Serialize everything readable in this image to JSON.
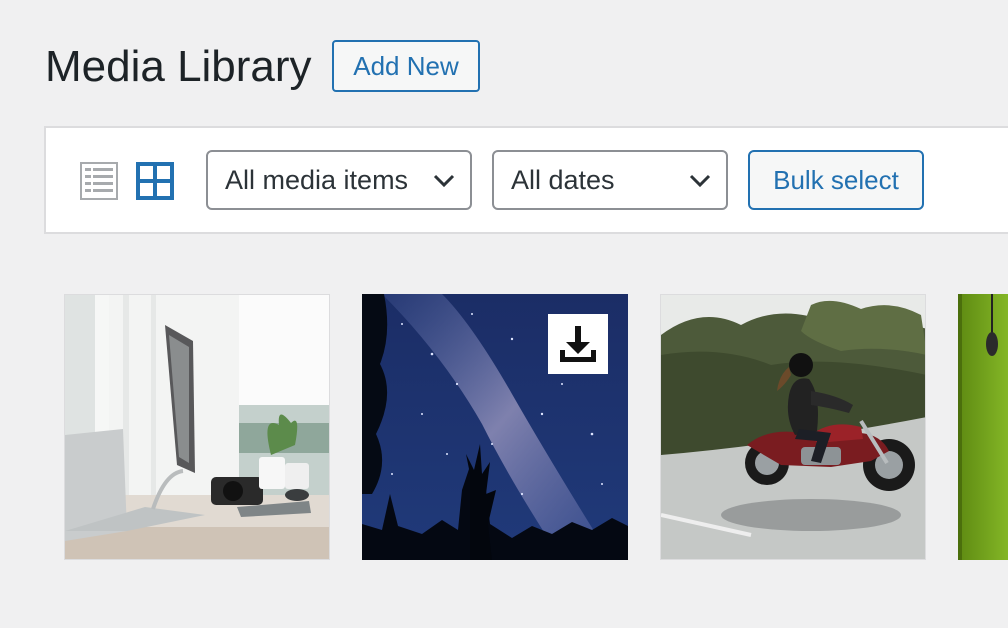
{
  "header": {
    "title": "Media Library",
    "add_new_label": "Add New"
  },
  "toolbar": {
    "list_view_icon": "list-view-icon",
    "grid_view_icon": "grid-view-icon",
    "active_view": "grid",
    "media_type_filter": {
      "selected": "All media items"
    },
    "date_filter": {
      "selected": "All dates"
    },
    "bulk_select_label": "Bulk select"
  },
  "media_items": [
    {
      "kind": "image",
      "subject": "desk-workspace"
    },
    {
      "kind": "image",
      "subject": "night-sky-milky-way",
      "badge_icon": "download-icon"
    },
    {
      "kind": "image",
      "subject": "motorcycle-rider"
    },
    {
      "kind": "image",
      "subject": "green-partial"
    }
  ],
  "colors": {
    "accent": "#2271b1",
    "page_background": "#f0f0f1",
    "panel_border": "#dcdcde",
    "heading_text": "#1d2327"
  }
}
